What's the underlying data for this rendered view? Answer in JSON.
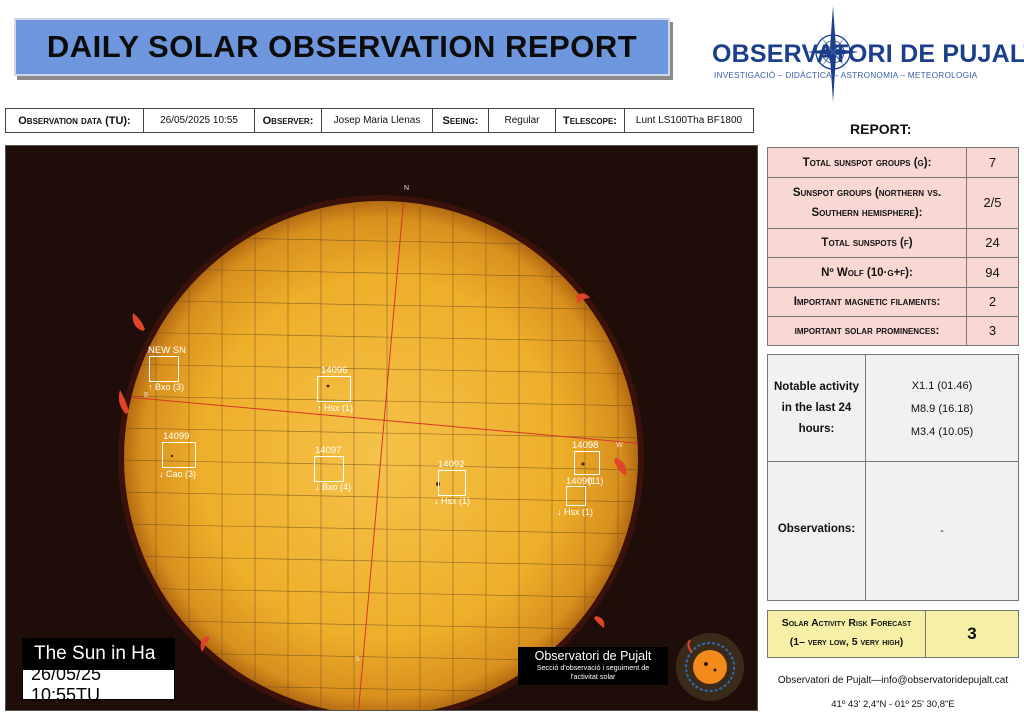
{
  "header": {
    "title": "DAILY SOLAR OBSERVATION REPORT"
  },
  "logo": {
    "name": "OBSERVATORI DE PUJALT",
    "subtitle": "INVESTIGACIÓ – DIDÀCTICA – ASTRONOMIA – METEOROLOGIA"
  },
  "info": {
    "date_label": "Observation data (TU):",
    "date_value": "26/05/2025 10:55",
    "observer_label": "Observer:",
    "observer_value": "Josep Maria Llenas",
    "seeing_label": "Seeing:",
    "seeing_value": "Regular",
    "telescope_label": "Telescope:",
    "telescope_value": "Lunt LS100Tha BF1800"
  },
  "image": {
    "caption_top": "The Sun in Ha",
    "caption_bottom": "26/05/25 10:55TU",
    "brand_name": "Observatori de Pujalt",
    "brand_sub_1": "Secció d'observació i seguiment de",
    "brand_sub_2": "l'activitat solar",
    "dir_n": "N",
    "dir_s": "S",
    "dir_e": "E",
    "dir_w": "W",
    "regions": [
      {
        "id": "NEW SN",
        "class": "↑ Bxo (3)"
      },
      {
        "id": "14096",
        "class": "↑ Hsx (1)"
      },
      {
        "id": "14099",
        "class": "↓ Cao (3)"
      },
      {
        "id": "14097",
        "class": "↓ Bxo (4)"
      },
      {
        "id": "14092",
        "class": "↓ Hsx (1)"
      },
      {
        "id": "14098",
        "class": "(11)"
      },
      {
        "id": "14090",
        "class": "↓ Hsx (1)"
      }
    ]
  },
  "report": {
    "title": "REPORT:",
    "rows": [
      {
        "label": "Total sunspot groups (g):",
        "value": "7"
      },
      {
        "label": "Sunspot groups (northern vs. Southern hemisphere):",
        "value": "2/5"
      },
      {
        "label": "Total sunspots (f)",
        "value": "24"
      },
      {
        "label": "Nº Wolf (10·g+f):",
        "value": "94"
      },
      {
        "label": "Important magnetic filaments:",
        "value": "2"
      },
      {
        "label": "important solar prominences:",
        "value": "3"
      }
    ],
    "notable_label": "Notable activity in the last 24 hours:",
    "notable_values": [
      "X1.1 (01.46)",
      "M8.9 (16.18)",
      "M3.4 (10.05)"
    ],
    "observations_label": "Observations:",
    "observations_value": "-",
    "risk_label_1": "Solar Activity Risk Forecast",
    "risk_label_2": "(1– very low, 5 very high)",
    "risk_value": "3"
  },
  "footer": {
    "contact": "Observatori de Pujalt—info@observatoridepujalt.cat",
    "coords": "41º 43' 2,4\"N - 01º 25' 30,8\"E"
  },
  "colors": {
    "banner": "#6f97dd",
    "report_cells": "#f9d7d2",
    "risk_cell": "#f5f0a6",
    "sun": "#f0b429",
    "background": "#1f0d09"
  }
}
